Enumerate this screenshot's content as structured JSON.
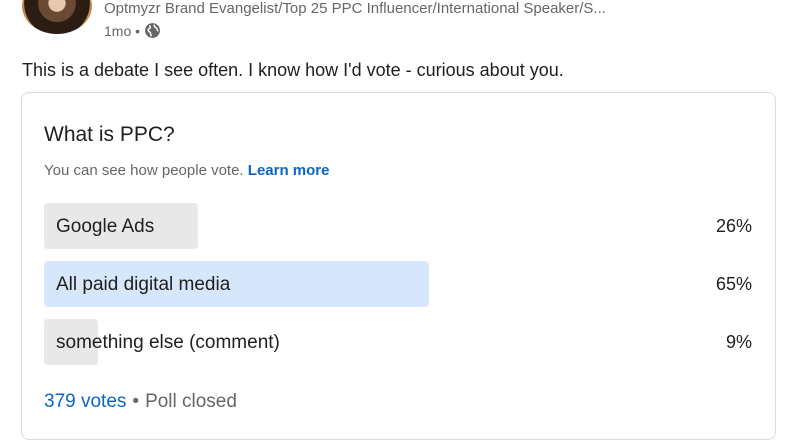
{
  "post": {
    "author_meta": "Optmyzr Brand Evangelist/Top 25 PPC Influencer/International Speaker/S...",
    "time": "1mo •",
    "text": "This is a debate I see often. I know how I'd vote - curious about you."
  },
  "poll": {
    "question": "What is PPC?",
    "subtitle": "You can see how people vote.",
    "learn_more": "Learn more",
    "options": [
      {
        "label": "Google Ads",
        "percent_label": "26%",
        "percent": 26,
        "selected": false
      },
      {
        "label": "All paid digital media",
        "percent_label": "65%",
        "percent": 65,
        "selected": true
      },
      {
        "label": "something else (comment)",
        "percent_label": "9%",
        "percent": 9,
        "selected": false
      }
    ],
    "votes": "379 votes",
    "separator": "•",
    "status": "Poll closed"
  },
  "colors": {
    "link": "#0a66c2",
    "selected_bar": "#d7e7fb",
    "bar": "#e8e8e8"
  }
}
